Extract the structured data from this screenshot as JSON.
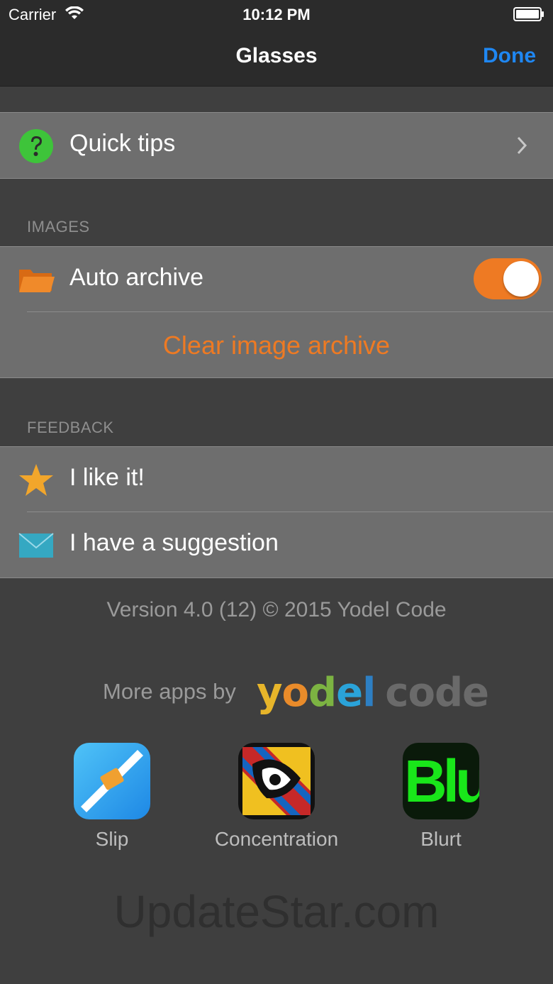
{
  "status": {
    "carrier": "Carrier",
    "time": "10:12 PM"
  },
  "nav": {
    "title": "Glasses",
    "done": "Done"
  },
  "quick_tips": {
    "label": "Quick tips",
    "icon": "question-icon"
  },
  "images": {
    "header": "IMAGES",
    "auto_archive": {
      "label": "Auto archive",
      "icon": "folder-icon",
      "enabled": true
    },
    "clear": "Clear image archive"
  },
  "feedback": {
    "header": "FEEDBACK",
    "like": {
      "label": "I like it!",
      "icon": "star-icon"
    },
    "suggest": {
      "label": "I have a suggestion",
      "icon": "mail-icon"
    }
  },
  "version": "Version 4.0 (12) © 2015 Yodel Code",
  "more_apps": "More apps by",
  "brand": {
    "yodel": "yodel",
    "code": "code"
  },
  "apps": [
    {
      "name": "Slip"
    },
    {
      "name": "Concentration"
    },
    {
      "name": "Blurt",
      "icon_text": "Blu"
    }
  ],
  "watermark": "UpdateStar.com",
  "colors": {
    "accent_orange": "#ee7a23",
    "link_blue": "#1f87f2",
    "green_icon": "#3ec43a"
  }
}
